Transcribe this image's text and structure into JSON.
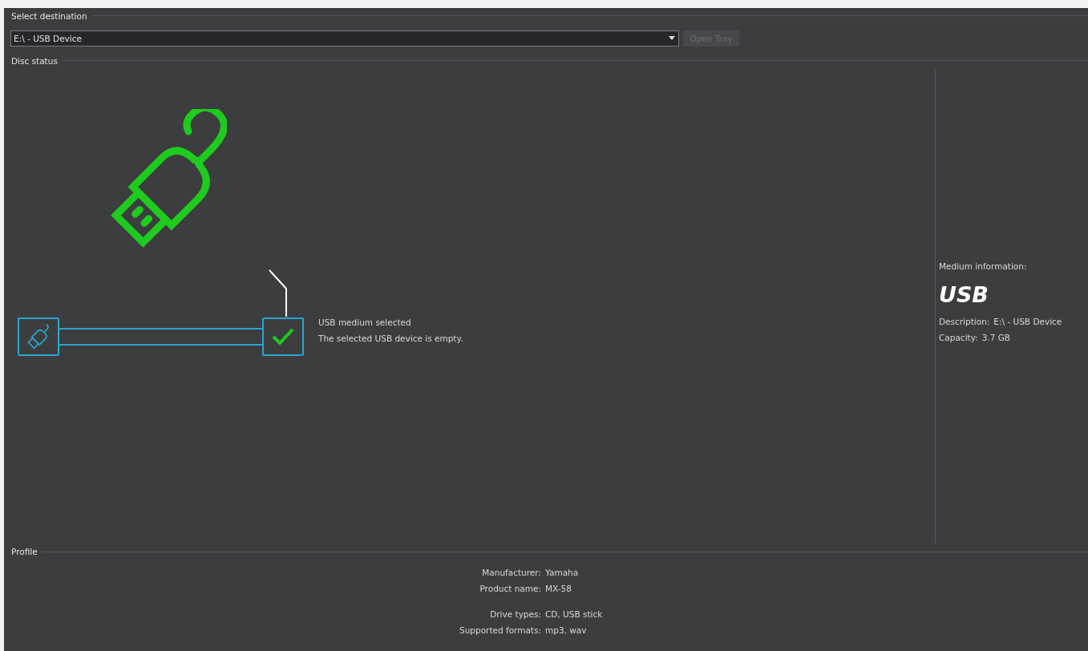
{
  "select_destination": {
    "title": "Select destination",
    "drive": {
      "value": "E:\\ - USB Device"
    },
    "open_tray": {
      "label": "Open Tray",
      "disabled": true
    }
  },
  "disc_status": {
    "title": "Disc status",
    "messages": [
      "USB medium selected",
      "The selected USB device is empty."
    ],
    "medium_information": {
      "heading": "Medium information:",
      "type": "USB",
      "details": [
        {
          "label": "Description:",
          "value": "E:\\ - USB Device"
        },
        {
          "label": "Capacity:",
          "value": "3.7 GB"
        }
      ]
    }
  },
  "profile": {
    "title": "Profile",
    "groups": [
      [
        {
          "label": "Manufacturer:",
          "value": "Yamaha"
        },
        {
          "label": "Product name:",
          "value": "MX-58"
        }
      ],
      [
        {
          "label": "Drive types:",
          "value": "CD, USB stick"
        },
        {
          "label": "Supported formats:",
          "value": "mp3, wav"
        }
      ]
    ]
  }
}
